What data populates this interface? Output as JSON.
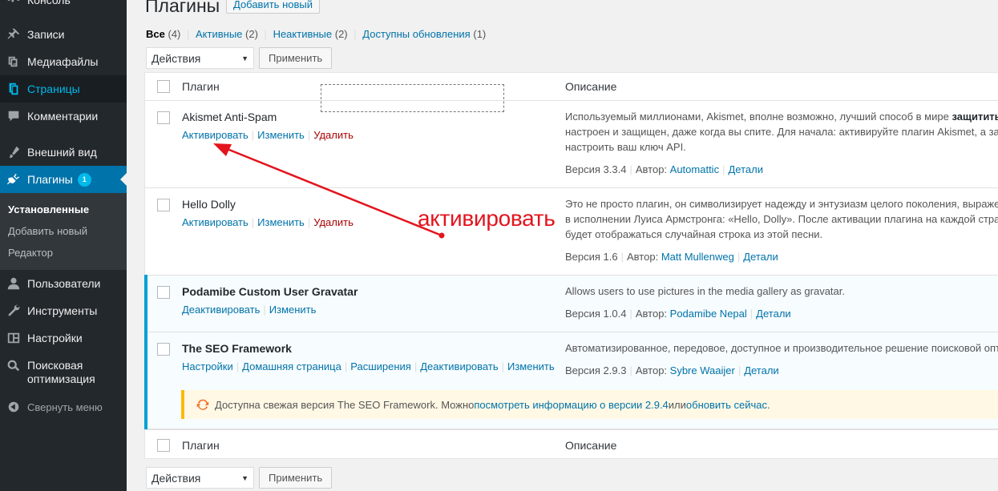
{
  "sidebar": {
    "top_item": "Консоль",
    "items": [
      {
        "label": "Записи",
        "icon": "pin-icon"
      },
      {
        "label": "Медиафайлы",
        "icon": "media-icon"
      },
      {
        "label": "Страницы",
        "icon": "pages-icon"
      },
      {
        "label": "Комментарии",
        "icon": "comments-icon"
      },
      {
        "label": "Внешний вид",
        "icon": "appearance-icon"
      },
      {
        "label": "Плагины",
        "icon": "plugins-icon",
        "badge": "1"
      },
      {
        "label": "Пользователи",
        "icon": "users-icon"
      },
      {
        "label": "Инструменты",
        "icon": "tools-icon"
      },
      {
        "label": "Настройки",
        "icon": "settings-icon"
      },
      {
        "label": "Поисковая",
        "label2": "оптимизация",
        "icon": "search-icon"
      },
      {
        "label": "Свернуть меню",
        "icon": "collapse-icon"
      }
    ],
    "submenu": [
      "Установленные",
      "Добавить новый",
      "Редактор"
    ]
  },
  "header": {
    "title": "Плагины",
    "add_new": "Добавить новый"
  },
  "filters": [
    {
      "label": "Все",
      "count": "(4)"
    },
    {
      "label": "Активные",
      "count": "(2)"
    },
    {
      "label": "Неактивные",
      "count": "(2)"
    },
    {
      "label": "Доступны обновления",
      "count": "(1)"
    }
  ],
  "bulk": {
    "select": "Действия",
    "apply": "Применить"
  },
  "table": {
    "col_plugin": "Плагин",
    "col_description": "Описание",
    "plugins": [
      {
        "name": "Akismet Anti-Spam",
        "actions": [
          "Активировать",
          "Изменить",
          "Удалить"
        ],
        "desc_lines": [
          "Используемый миллионами, Akismet, вполне возможно, лучший способ в мире ",
          "настроен и защищен, даже когда вы спите. Для начала: активируйте плагин Akismet, а зате",
          "настроить ваш ключ API."
        ],
        "desc_bold": "защитить",
        "version": "Версия 3.3.4",
        "author_label": "Автор:",
        "author": "Automattic",
        "details": "Детали"
      },
      {
        "name": "Hello Dolly",
        "actions": [
          "Активировать",
          "Изменить",
          "Удалить"
        ],
        "desc_lines": [
          "Это не просто плагин, он символизирует надежду и энтузиазм целого поколения, выраже",
          "в исполнении Луиса Армстронга: «Hello, Dolly». После активации плагина на каждой стран",
          "будет отображаться случайная строка из этой песни."
        ],
        "version": "Версия 1.6",
        "author_label": "Автор:",
        "author": "Matt Mullenweg",
        "details": "Детали"
      },
      {
        "name": "Podamibe Custom User Gravatar",
        "actions": [
          "Деактивировать",
          "Изменить"
        ],
        "desc_lines": [
          "Allows users to use pictures in the media gallery as gravatar."
        ],
        "version": "Версия 1.0.4",
        "author_label": "Автор:",
        "author": "Podamibe Nepal",
        "details": "Детали"
      },
      {
        "name": "The SEO Framework",
        "actions": [
          "Настройки",
          "Домашняя страница",
          "Расширения",
          "Деактивировать",
          "Изменить"
        ],
        "desc_lines": [
          "Автоматизированное, передовое, доступное и производительное решение поисковой опт"
        ],
        "version": "Версия 2.9.3",
        "author_label": "Автор:",
        "author": "Sybre Waaijer",
        "details": "Детали"
      }
    ]
  },
  "update_notice": {
    "text_before": "Доступна свежая версия The SEO Framework. Можно ",
    "link1": "посмотреть информацию о версии 2.9.4",
    "text_mid": " или ",
    "link2": "обновить сейчас",
    "text_after": "."
  },
  "annotation": {
    "text": "активировать",
    "color": "#e3141d"
  },
  "colors": {
    "sidebar_bg": "#23282d",
    "accent": "#0073aa",
    "active_border": "#00a0d2",
    "notice_border": "#ffb900"
  }
}
